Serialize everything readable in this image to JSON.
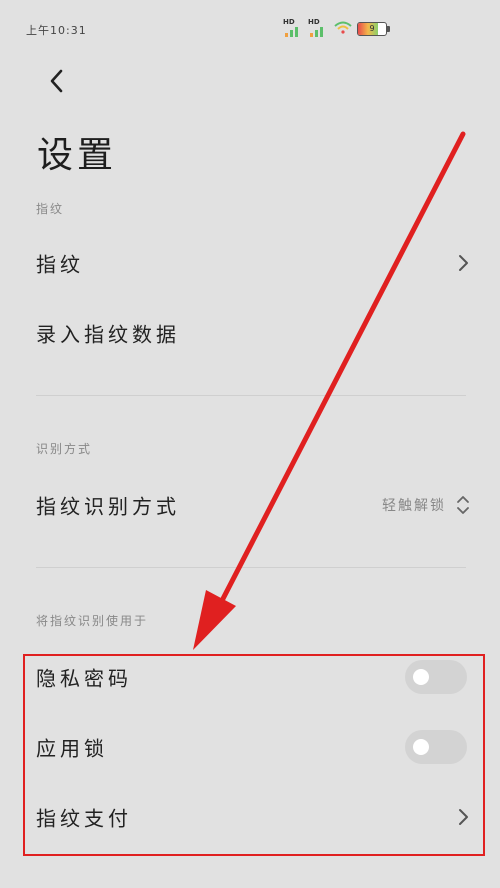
{
  "status_bar": {
    "time": "上午10:31",
    "signal1": "HD",
    "signal2": "HD",
    "battery": "9"
  },
  "header": {
    "title": "设置"
  },
  "sections": {
    "fingerprint": {
      "header": "指纹",
      "item1": "指纹",
      "item2": "录入指纹数据"
    },
    "recognition": {
      "header": "识别方式",
      "item_label": "指纹识别方式",
      "item_value": "轻触解锁"
    },
    "usage": {
      "header": "将指纹识别使用于",
      "privacy": {
        "label": "隐私密码",
        "on": false
      },
      "app_lock": {
        "label": "应用锁",
        "on": false
      },
      "payment": {
        "label": "指纹支付"
      }
    }
  },
  "colors": {
    "background": "#e1e1e1",
    "annotation": "#e02020",
    "toggle_off": "#d3d3d3"
  }
}
